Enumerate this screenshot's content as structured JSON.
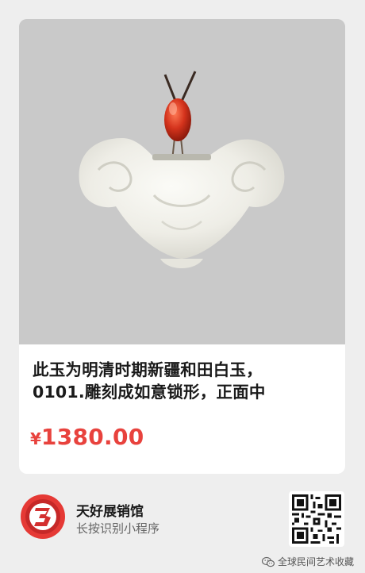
{
  "product": {
    "title_line1": "此玉为明清时期新疆和田白玉，",
    "title_line2": "0101.雕刻成如意锁形，正面中",
    "price_symbol": "¥",
    "price_value": "1380.00",
    "image_icon": "jade-lock-pendant-image"
  },
  "shop": {
    "name": "天好展销馆",
    "hint": "长按识别小程序",
    "logo_icon": "red-three-logo",
    "qr_icon": "qr-code"
  },
  "watermark": {
    "text": "全球民间艺术收藏",
    "icon": "wechat-icon"
  },
  "colors": {
    "price": "#e8423d",
    "image_bg": "#c9c9c9",
    "logo_red": "#e53935"
  }
}
